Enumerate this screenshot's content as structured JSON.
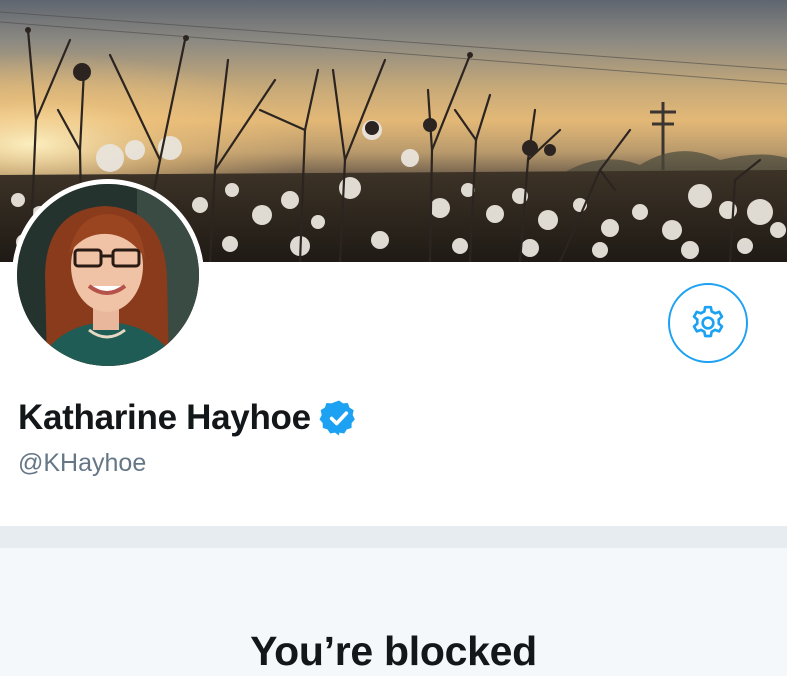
{
  "profile": {
    "display_name": "Katharine Hayhoe",
    "handle": "@KHayhoe",
    "verified": true
  },
  "banner": {
    "description_icon": "cotton-field-photo"
  },
  "actions": {
    "settings_icon": "gear-icon"
  },
  "blocked": {
    "title": "You’re blocked"
  },
  "colors": {
    "accent": "#1da1f2",
    "name_text": "#14171a",
    "handle_text": "#657786",
    "divider": "#e6ecf0",
    "panel_bg": "#f5f8fa"
  }
}
